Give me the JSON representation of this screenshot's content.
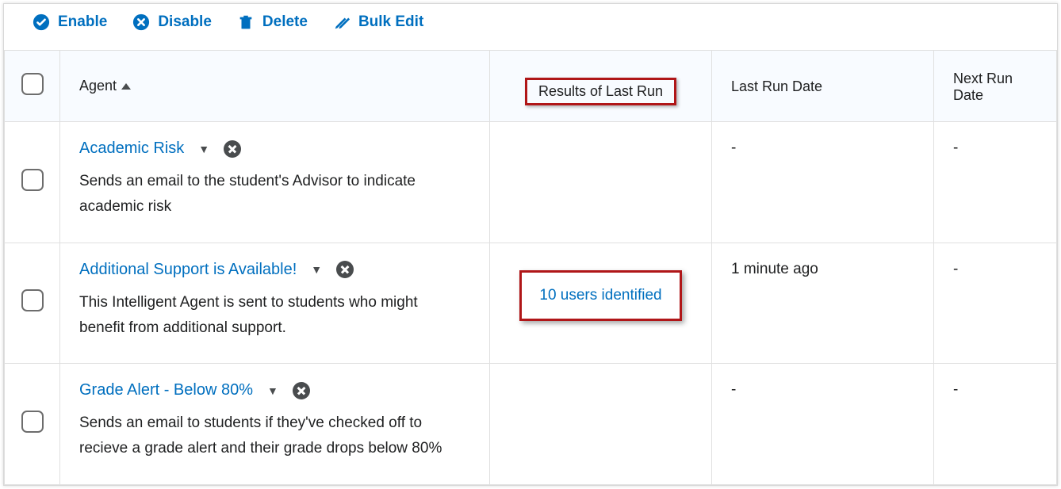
{
  "toolbar": {
    "enable": "Enable",
    "disable": "Disable",
    "delete": "Delete",
    "bulkedit": "Bulk Edit"
  },
  "columns": {
    "agent": "Agent",
    "results": "Results of Last Run",
    "lastrun": "Last Run Date",
    "nextrun": "Next Run Date"
  },
  "rows": [
    {
      "name": "Academic Risk",
      "desc": "Sends an email to the student's Advisor to indicate academic risk",
      "results": "",
      "lastrun": "-",
      "nextrun": "-"
    },
    {
      "name": "Additional Support is Available!",
      "desc": "This Intelligent Agent is sent to students who might benefit from additional support.",
      "results": "10 users identified",
      "lastrun": "1 minute ago",
      "nextrun": "-"
    },
    {
      "name": "Grade Alert - Below 80%",
      "desc": "Sends an email to students if they've checked off to recieve a grade alert and their grade drops below 80%",
      "results": "",
      "lastrun": "-",
      "nextrun": "-"
    }
  ]
}
